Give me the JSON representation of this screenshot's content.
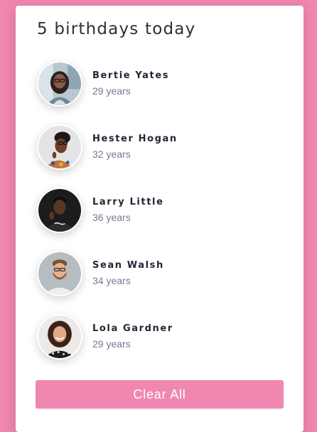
{
  "theme": {
    "background": "#f087b0",
    "card": "#ffffff",
    "button": "#f087b0",
    "name_color": "#1f2633",
    "age_color": "#6f7b8f"
  },
  "title": "5 birthdays today",
  "people": [
    {
      "name": "Bertie Yates",
      "age": "29 years",
      "avatar": "woman-with-glasses-photo"
    },
    {
      "name": "Hester Hogan",
      "age": "32 years",
      "avatar": "woman-with-glasses-profile-photo"
    },
    {
      "name": "Larry Little",
      "age": "36 years",
      "avatar": "man-dark-background-photo"
    },
    {
      "name": "Sean Walsh",
      "age": "34 years",
      "avatar": "bearded-man-glasses-photo"
    },
    {
      "name": "Lola Gardner",
      "age": "29 years",
      "avatar": "smiling-woman-curly-hair-photo"
    }
  ],
  "clear_button": {
    "label": "Clear All"
  }
}
